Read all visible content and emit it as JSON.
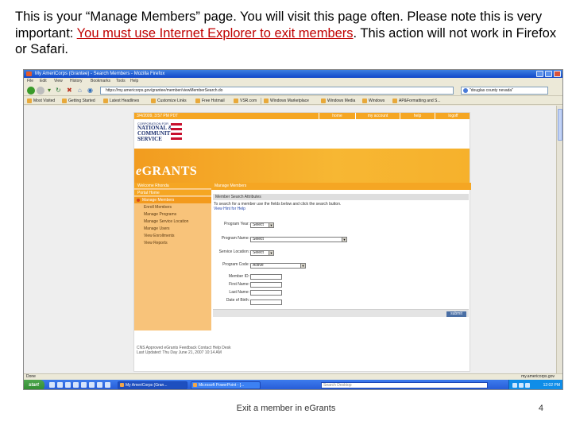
{
  "slide": {
    "caption_part1": "This is your “Manage Members” page.  You will visit this page often.  Please note this is very important:  ",
    "caption_highlight": "You must use Internet Explorer to exit members",
    "caption_part2": ".  This action will not work in Firefox or Safari.",
    "footer_title": "Exit a member in eGrants",
    "page_number": "4",
    "highlight_color": "#c00000"
  },
  "browser": {
    "window_title": "My AmeriCorps (Grantee) - Search Members - Mozilla Firefox",
    "menu": [
      "File",
      "Edit",
      "View",
      "History",
      "Bookmarks",
      "Tools",
      "Help"
    ],
    "url": "https://my.americorps.gov/grantee/member/viewMemberSearch.do",
    "search_value": "\"douglas county nevada\"",
    "bookmarks": [
      "Most Visited",
      "Getting Started",
      "Latest Headlines",
      "Customize Links",
      "Free Hotmail",
      "VSR.com",
      "Windows Marketplace",
      "Windows Media",
      "Windows",
      "AP&Formatting and S..."
    ],
    "status": "Done",
    "status_right": "my.americorps.gov"
  },
  "egrants": {
    "date": "3/4/2009, 3:57 PM PDT",
    "top_nav": [
      "home",
      "my account",
      "help",
      "logoff"
    ],
    "logo_lines": [
      "CORPORATION FOR",
      "NATIONAL &",
      "COMMUNITY",
      "SERVICE"
    ],
    "brand_e": "e",
    "brand_rest": "GRANTS",
    "left_nav": {
      "header": "Welcome Rhonda",
      "portal": "Portal Home",
      "active": "Manage Members",
      "items": [
        "Enroll Members",
        "Manage Programs",
        "Manage Service Location",
        "Manage Users",
        "View Enrollments",
        "View Reports"
      ]
    },
    "main_header": "Manage Members",
    "section_header": "Member Search Attributes",
    "instructions": "To search for a member use the fields below and click the search button.",
    "help_link": "View Hint for Help",
    "fields": {
      "program_year_label": "Program Year:",
      "program_year_value": "Select",
      "program_name_label": "Program Name:",
      "program_name_value": "Select",
      "service_location_label": "Service Location:",
      "service_location_value": "Select",
      "program_code_label": "Program Code:",
      "program_code_value": "Active",
      "member_id_label": "Member ID:",
      "first_name_label": "First Name:",
      "last_name_label": "Last Name:",
      "dob_label": "Date of Birth:"
    },
    "submit_label": "submit",
    "footer_line1": "CNS Approved  eGrants Feedback  Contact Help Desk",
    "footer_line2": "Last Updated: Thu Day June 21, 2007 10:14 AM"
  },
  "taskbar": {
    "start": "start",
    "buttons": [
      "My AmeriCorps (Gran...",
      "Microsoft PowerPoint - [..."
    ],
    "search_placeholder": "Search Desktop",
    "clock": "12:02 PM"
  }
}
